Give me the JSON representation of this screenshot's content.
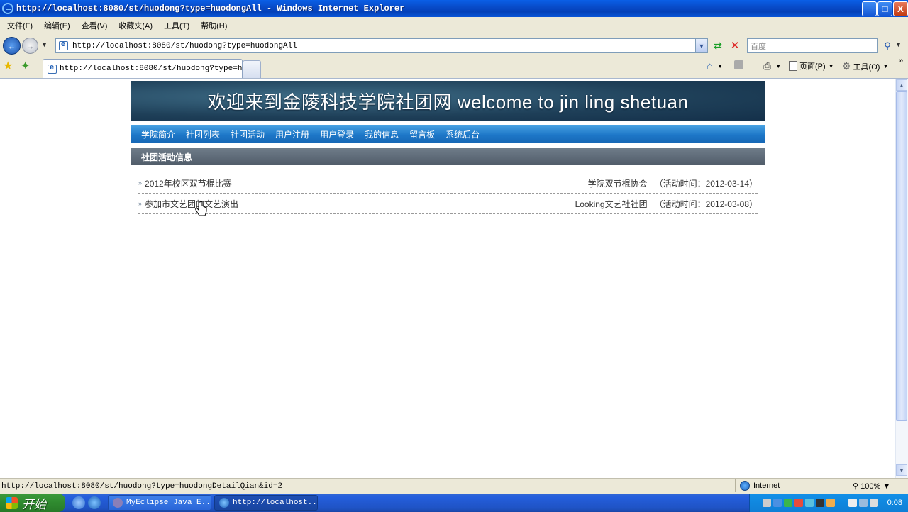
{
  "window": {
    "title": "http://localhost:8080/st/huodong?type=huodongAll - Windows Internet Explorer",
    "minimize": "_",
    "maximize": "□",
    "close": "X"
  },
  "menubar": [
    "文件(F)",
    "编辑(E)",
    "查看(V)",
    "收藏夹(A)",
    "工具(T)",
    "帮助(H)"
  ],
  "address": {
    "url": "http://localhost:8080/st/huodong?type=huodongAll",
    "search_placeholder": "百度"
  },
  "tab": {
    "title": "http://localhost:8080/st/huodong?type=huo..."
  },
  "command_bar": {
    "page": "页面(P)",
    "tools": "工具(O)"
  },
  "site": {
    "banner": "欢迎来到金陵科技学院社团网  welcome to jin ling shetuan",
    "nav": [
      "学院简介",
      "社团列表",
      "社团活动",
      "用户注册",
      "用户登录",
      "我的信息",
      "留言板",
      "系统后台"
    ],
    "section_title": "社团活动信息",
    "activities": [
      {
        "title": "2012年校区双节棍比赛",
        "org": "学院双节棍协会",
        "date": "（活动时间：2012-03-14）"
      },
      {
        "title": "参加市文艺团的文艺演出",
        "org": "Looking文艺社社团",
        "date": "（活动时间：2012-03-08）"
      }
    ]
  },
  "status": {
    "text": "http://localhost:8080/st/huodong?type=huodongDetailQian&id=2",
    "zone": "Internet",
    "zoom": "100%"
  },
  "taskbar": {
    "start": "开始",
    "tasks": [
      "MyEclipse Java E...",
      "http://localhost..."
    ],
    "clock": "0:08"
  },
  "colors": {
    "titlebar": "#0849c6",
    "navbar": "#1d77c8",
    "section": "#5a6673",
    "taskbar": "#245edc",
    "start": "#2f8a2f"
  }
}
